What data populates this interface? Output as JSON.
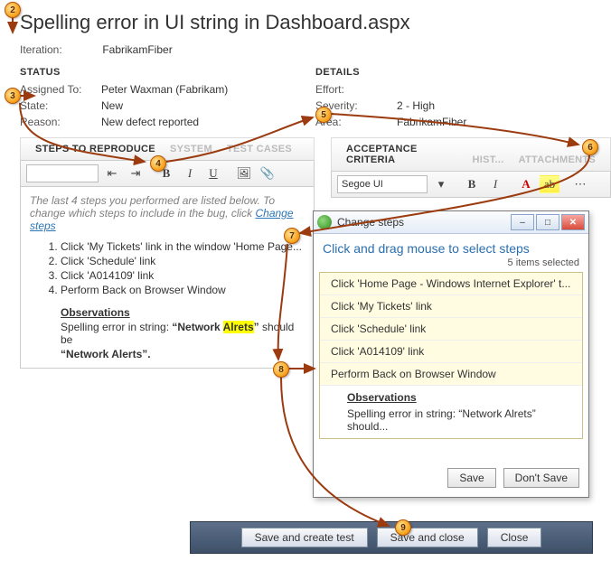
{
  "title": "Spelling error in UI string in Dashboard.aspx",
  "iteration": {
    "label": "Iteration:",
    "value": "FabrikamFiber"
  },
  "status": {
    "header": "STATUS",
    "assigned_to": {
      "k": "Assigned To:",
      "v": "Peter Waxman (Fabrikam)"
    },
    "state": {
      "k": "State:",
      "v": "New"
    },
    "reason": {
      "k": "Reason:",
      "v": "New defect reported"
    }
  },
  "details": {
    "header": "DETAILS",
    "effort": {
      "k": "Effort:",
      "v": ""
    },
    "severity": {
      "k": "Severity:",
      "v": "2 - High"
    },
    "area": {
      "k": "Area:",
      "v": "FabrikamFiber"
    }
  },
  "steps_tabs": {
    "t0": "STEPS TO REPRODUCE",
    "t1": "SYSTEM",
    "t2": "TEST CASES"
  },
  "acc_tabs": {
    "t0": "ACCEPTANCE CRITERIA",
    "t1": "HIST...",
    "t2": "ATTACHMENTS"
  },
  "steps_toolbar": {
    "dd_value": "",
    "bold": "B",
    "ital": "I",
    "und": "U"
  },
  "acc_toolbar": {
    "font": "Segoe UI",
    "bold": "B",
    "ital": "I",
    "a": "A"
  },
  "repro": {
    "hint_a": "The last 4 steps you performed are listed below. To change which steps to include in the bug, click ",
    "hint_link": "Change steps",
    "s1": "Click 'My Tickets' link in the window 'Home Page...",
    "s2": "Click 'Schedule' link",
    "s3": "Click 'A014109' link",
    "s4": "Perform Back on Browser Window",
    "obs_h": "Observations",
    "obs_a": "Spelling error in string: ",
    "obs_q1": "“Network ",
    "obs_hl": "Alrets",
    "obs_q2": "”",
    "obs_tail": " should be ",
    "obs_line2": "“Network Alerts”."
  },
  "cs": {
    "title": "Change steps",
    "sub": "Click and drag mouse to select steps",
    "count": "5 items selected",
    "r0": "Click 'Home Page - Windows Internet Explorer' t...",
    "r1": "Click 'My Tickets' link",
    "r2": "Click 'Schedule' link",
    "r3": "Click 'A014109' link",
    "r4": "Perform Back on Browser Window",
    "obs_h": "Observations",
    "obs_d": "Spelling error in string: “Network Alrets” should...",
    "save": "Save",
    "dont": "Don't Save"
  },
  "bottom": {
    "save_create": "Save and create test",
    "save_close": "Save and close",
    "close": "Close"
  },
  "win_btns": {
    "min": "‒",
    "max": "□",
    "close": "✕"
  }
}
